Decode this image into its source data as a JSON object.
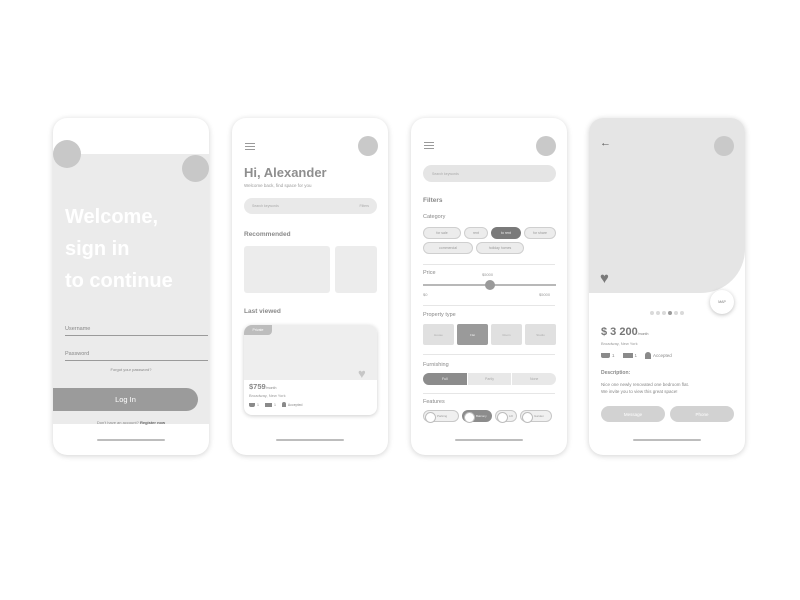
{
  "login": {
    "welcome_line1": "Welcome,",
    "welcome_line2": "sign in",
    "welcome_line3": "to continue",
    "username_placeholder": "Username",
    "password_placeholder": "Password",
    "forgot": "Forgot your password?",
    "login_button": "Log In",
    "no_account": "Don't have an account?",
    "register": "Register now"
  },
  "home": {
    "greeting": "Hi, Alexander",
    "subtitle": "Welcome back, find space for you",
    "search_placeholder": "Search keywords",
    "filters_label": "Filters",
    "recommended_title": "Recommended",
    "last_viewed_title": "Last viewed",
    "card_badge": "Private",
    "card_price": "$759",
    "card_price_unit": "/month",
    "card_address": "Broadway, New York",
    "card_bath": "1",
    "card_bed": "1",
    "card_pets": "Accepted"
  },
  "filters": {
    "search_placeholder": "Search keywords",
    "title": "Filters",
    "category_label": "Category",
    "categories": [
      {
        "label": "for sale",
        "selected": false
      },
      {
        "label": "rent",
        "selected": false
      },
      {
        "label": "to rent",
        "selected": true
      },
      {
        "label": "for share",
        "selected": false
      },
      {
        "label": "commercial",
        "selected": false
      },
      {
        "label": "holiday homes",
        "selected": false
      }
    ],
    "price_label": "Price",
    "price_value": "$5000",
    "price_min": "$0",
    "price_max": "$5000",
    "price_level": 0.5,
    "property_type_label": "Property type",
    "property_types": [
      {
        "label": "House",
        "selected": false
      },
      {
        "label": "Flat",
        "selected": true
      },
      {
        "label": "Room",
        "selected": false
      },
      {
        "label": "Studio",
        "selected": false
      }
    ],
    "furnishing_label": "Furnishing",
    "furnishing": [
      {
        "label": "Full",
        "selected": true
      },
      {
        "label": "Partly",
        "selected": false
      },
      {
        "label": "None",
        "selected": false
      }
    ],
    "features_label": "Features",
    "features": [
      {
        "label": "Parking",
        "selected": false
      },
      {
        "label": "Balcony",
        "selected": true
      },
      {
        "label": "Lift",
        "selected": false
      },
      {
        "label": "Garden",
        "selected": false
      }
    ]
  },
  "detail": {
    "map_label": "MAP",
    "price": "$ 3 200",
    "price_unit": "/month",
    "address": "Broadway, New York",
    "bath": "1",
    "bed": "1",
    "pets": "Accepted",
    "description_label": "Description:",
    "description_line1": "Nice one newly renovated one bedroom flat.",
    "description_line2": "We invite you to view this great space!",
    "message_button": "Message",
    "phone_button": "Phone",
    "active_photo_index": 3,
    "photo_count": 6
  }
}
